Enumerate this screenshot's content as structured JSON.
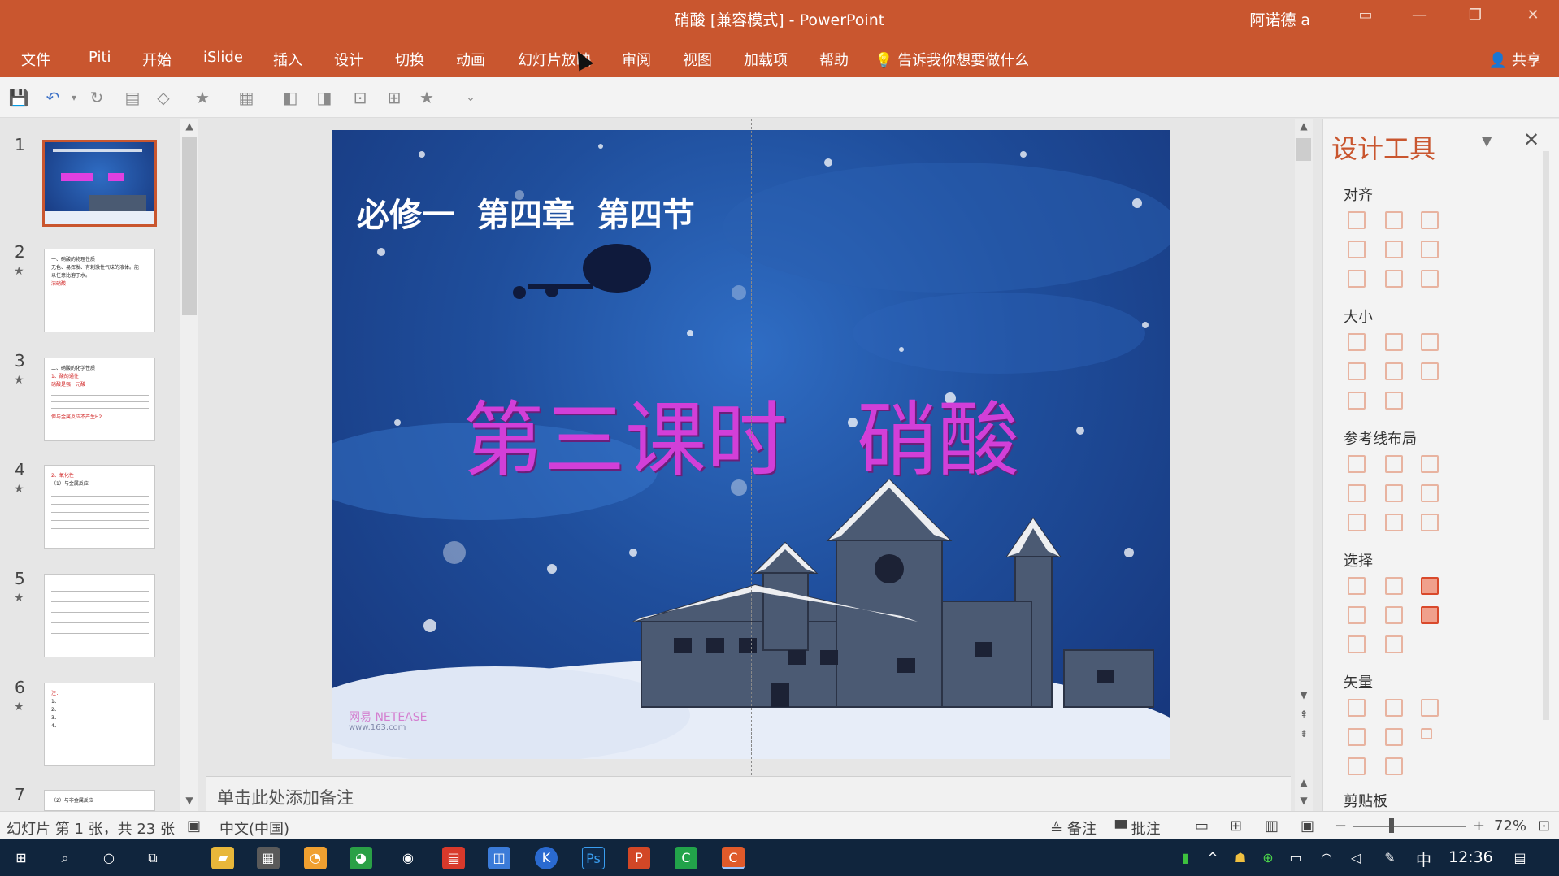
{
  "titlebar": {
    "title": "硝酸 [兼容模式]  -  PowerPoint",
    "user": "阿诺德 a"
  },
  "ribbon": {
    "tabs": [
      "文件",
      "Piti",
      "开始",
      "iSlide",
      "插入",
      "设计",
      "切换",
      "动画",
      "幻灯片放映",
      "审阅",
      "视图",
      "加载项",
      "帮助"
    ],
    "tell_me": "告诉我你想要做什么",
    "share": "共享"
  },
  "thumbnails": [
    {
      "num": "1",
      "selected": true,
      "lines": []
    },
    {
      "num": "2",
      "selected": false,
      "lines": [
        "一、硝酸的物理性质",
        "无色、易挥发、有刺激性气味的液体。能",
        "以任意比溶于水。",
        "浓硝酸"
      ]
    },
    {
      "num": "3",
      "selected": false,
      "lines": [
        "二、硝酸的化学性质",
        "1、酸的通性",
        "硝酸是强一元酸",
        "",
        "",
        "但与金属反应不产生H2"
      ]
    },
    {
      "num": "4",
      "selected": false,
      "lines": [
        "2、氧化性",
        "（1）与金属反应",
        "",
        "",
        ""
      ]
    },
    {
      "num": "5",
      "selected": false,
      "lines": [
        "",
        "",
        "",
        ""
      ]
    },
    {
      "num": "6",
      "selected": false,
      "lines": [
        "注：",
        "1、",
        "2、",
        "3、",
        "4、"
      ]
    },
    {
      "num": "7",
      "selected": false,
      "lines": [
        "（2）与非金属反应"
      ]
    }
  ],
  "slide": {
    "header": "必修一  第四章  第四节",
    "title_left": "第三课时",
    "title_right": "硝酸",
    "watermark_line1": "网易 NETEASE",
    "watermark_line2": "www.163.com"
  },
  "notes": {
    "placeholder": "单击此处添加备注"
  },
  "panel": {
    "title": "设计工具",
    "sections": [
      "对齐",
      "大小",
      "参考线布局",
      "选择",
      "矢量",
      "剪贴板"
    ]
  },
  "status": {
    "slide_info": "幻灯片 第 1 张，共 23 张",
    "language": "中文(中国)",
    "notes_btn": "备注",
    "comments_btn": "批注",
    "zoom": "72%"
  },
  "taskbar": {
    "ime": "中",
    "time": "12:36"
  },
  "colors": {
    "accent": "#c9562f",
    "slide_title": "#d23fd8"
  }
}
